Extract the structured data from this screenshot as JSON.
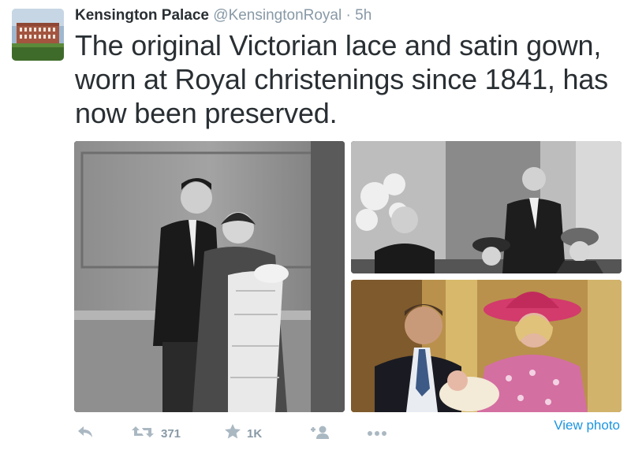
{
  "tweet": {
    "display_name": "Kensington Palace",
    "handle": "@KensingtonRoyal",
    "separator": "·",
    "time": "5h",
    "text": "The original Victorian lace and satin gown, worn at Royal christenings since 1841, has now been preserved."
  },
  "media": [
    {
      "name": "christening-photo-couple"
    },
    {
      "name": "christening-photo-group"
    },
    {
      "name": "christening-photo-charles-diana"
    }
  ],
  "actions": {
    "reply_icon": "reply-icon",
    "retweet_icon": "retweet-icon",
    "retweet_count": "371",
    "favorite_icon": "star-icon",
    "favorite_count": "1K",
    "follow_icon": "follow-icon",
    "more_icon": "more-icon",
    "view_photo": "View photo"
  },
  "colors": {
    "text": "#292f33",
    "muted": "#8899a6",
    "link": "#1b95e0",
    "icon": "#aab8c2"
  }
}
